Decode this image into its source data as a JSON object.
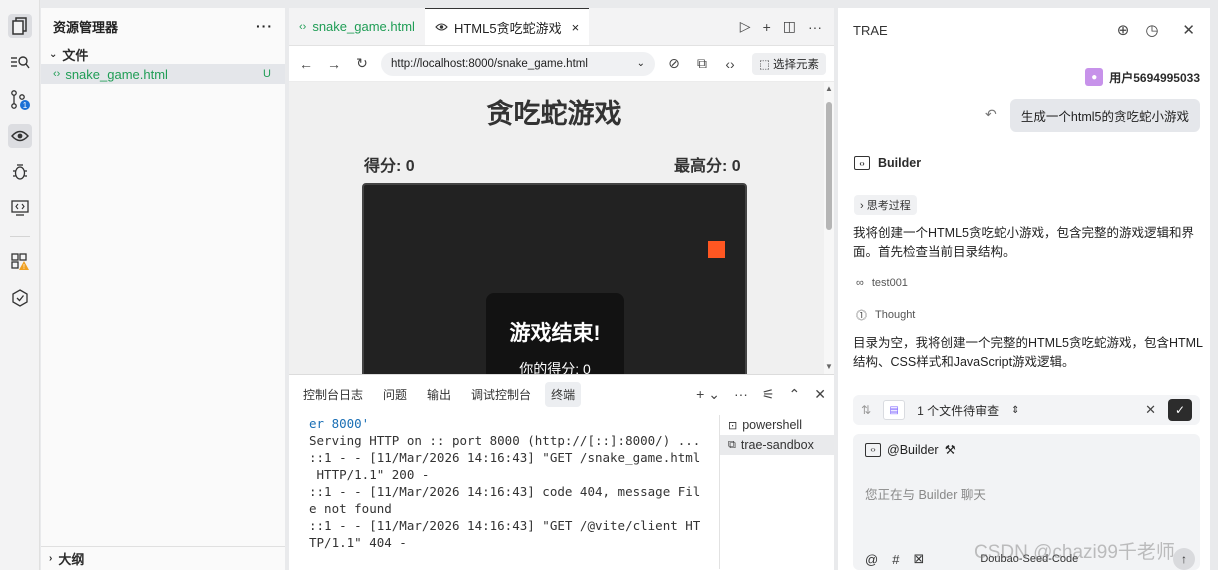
{
  "activity": {
    "icons": [
      "files-icon",
      "search-icon",
      "source-control-icon",
      "preview-icon",
      "debug-icon",
      "remote-icon",
      "extensions-icon",
      "agent-icon"
    ],
    "source_control_badge": "1"
  },
  "explorer": {
    "title": "资源管理器",
    "more": "···",
    "folder_label": "文件",
    "file_name": "snake_game.html",
    "file_status": "U",
    "outline_label": "大纲"
  },
  "editor": {
    "tab_file": "snake_game.html",
    "tab_preview": "HTML5贪吃蛇游戏",
    "url": "http://localhost:8000/snake_game.html",
    "select_element": "选择元素"
  },
  "game": {
    "title": "贪吃蛇游戏",
    "score_label": "得分: 0",
    "high_score_label": "最高分: 0",
    "game_over": "游戏结束!",
    "your_score": "你的得分: 0",
    "food_color": "#ff5722"
  },
  "panel": {
    "tabs": [
      "控制台日志",
      "问题",
      "输出",
      "调试控制台",
      "终端"
    ],
    "active_tab": "终端",
    "terminal_lines": [
      "er 8000'",
      "Serving HTTP on :: port 8000 (http://[::]:8000/) ...",
      "::1 - - [11/Mar/2026 14:16:43] \"GET /snake_game.html",
      " HTTP/1.1\" 200 -",
      "::1 - - [11/Mar/2026 14:16:43] code 404, message Fil",
      "e not found",
      "::1 - - [11/Mar/2026 14:16:43] \"GET /@vite/client HT",
      "TP/1.1\" 404 -"
    ],
    "terminals": [
      "powershell",
      "trae-sandbox"
    ]
  },
  "ai": {
    "title": "TRAE",
    "user_name": "用户5694995033",
    "user_message": "生成一个html5的贪吃蛇小游戏",
    "agent_name": "Builder",
    "thinking_label": "思考过程",
    "message_1": "我将创建一个HTML5贪吃蛇小游戏，包含完整的游戏逻辑和界面。首先检查当前目录结构。",
    "tool_label": "test001",
    "thought_label": "Thought",
    "message_2": "目录为空，我将创建一个完整的HTML5贪吃蛇游戏，包含HTML结构、CSS样式和JavaScript游戏逻辑。",
    "pending_text": "1 个文件待审查",
    "input_chip": "@Builder",
    "input_placeholder": "您正在与 Builder 聊天",
    "model_name": "Doubao-Seed-Code"
  },
  "watermark": "CSDN @chazi99千老师"
}
